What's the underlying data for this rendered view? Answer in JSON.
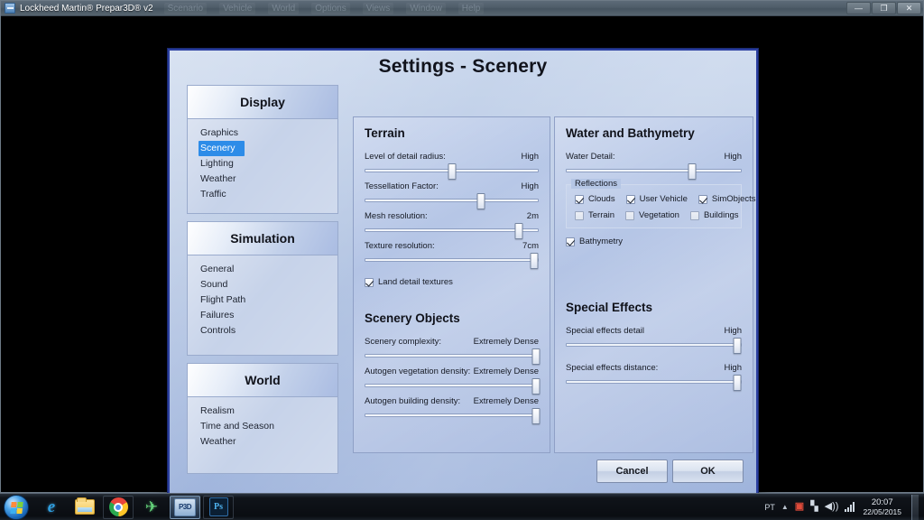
{
  "window": {
    "title": "Lockheed Martin® Prepar3D® v2",
    "icon": "app-icon",
    "menu": [
      "Scenario",
      "Vehicle",
      "World",
      "Options",
      "Views",
      "Window",
      "Help"
    ],
    "controls": {
      "minimize": "—",
      "maximize": "❐",
      "close": "✕"
    }
  },
  "dialog": {
    "title": "Settings - Scenery",
    "buttons": {
      "cancel": "Cancel",
      "ok": "OK"
    }
  },
  "nav": {
    "sections": [
      {
        "header": "Display",
        "items": [
          "Graphics",
          "Scenery",
          "Lighting",
          "Weather",
          "Traffic"
        ],
        "selected": "Scenery"
      },
      {
        "header": "Simulation",
        "items": [
          "General",
          "Sound",
          "Flight Path",
          "Failures",
          "Controls"
        ],
        "selected": ""
      },
      {
        "header": "World",
        "items": [
          "Realism",
          "Time and Season",
          "Weather"
        ],
        "selected": ""
      }
    ]
  },
  "terrain": {
    "title": "Terrain",
    "sliders": [
      {
        "label": "Level of detail radius:",
        "value": "High",
        "percent": 50
      },
      {
        "label": "Tessellation Factor:",
        "value": "High",
        "percent": 67
      },
      {
        "label": "Mesh resolution:",
        "value": "2m",
        "percent": 89
      },
      {
        "label": "Texture resolution:",
        "value": "7cm",
        "percent": 98
      }
    ],
    "land_detail_textures": {
      "label": "Land detail textures",
      "checked": true
    }
  },
  "scenery_objects": {
    "title": "Scenery Objects",
    "sliders": [
      {
        "label": "Scenery complexity:",
        "value": "Extremely Dense",
        "percent": 100
      },
      {
        "label": "Autogen vegetation density:",
        "value": "Extremely Dense",
        "percent": 100
      },
      {
        "label": "Autogen building density:",
        "value": "Extremely Dense",
        "percent": 100
      }
    ]
  },
  "water": {
    "title": "Water and Bathymetry",
    "sliders": [
      {
        "label": "Water Detail:",
        "value": "High",
        "percent": 72
      }
    ],
    "reflections": {
      "legend": "Reflections",
      "row1": [
        {
          "label": "Clouds",
          "checked": true
        },
        {
          "label": "User Vehicle",
          "checked": true
        },
        {
          "label": "SimObjects",
          "checked": true
        }
      ],
      "row2": [
        {
          "label": "Terrain",
          "checked": false
        },
        {
          "label": "Vegetation",
          "checked": false
        },
        {
          "label": "Buildings",
          "checked": false
        }
      ]
    },
    "bathymetry": {
      "label": "Bathymetry",
      "checked": true
    }
  },
  "special_effects": {
    "title": "Special Effects",
    "sliders": [
      {
        "label": "Special effects detail",
        "value": "High",
        "percent": 97
      },
      {
        "label": "Special effects distance:",
        "value": "High",
        "percent": 97
      }
    ]
  },
  "taskbar": {
    "start": "start-orb",
    "tasks": [
      {
        "name": "internet-explorer",
        "glyph": "e"
      },
      {
        "name": "windows-explorer",
        "glyph": ""
      },
      {
        "name": "google-chrome",
        "glyph": ""
      },
      {
        "name": "flight-sim",
        "glyph": "✈"
      },
      {
        "name": "prepar3d",
        "glyph": "P3D"
      },
      {
        "name": "photoshop",
        "glyph": "Ps"
      }
    ],
    "tray": {
      "language": "PT",
      "chevron": "▲",
      "icons": [
        "antivirus-icon",
        "network-icon",
        "volume-icon",
        "signal-icon"
      ],
      "volume_glyph": "🔊",
      "network_glyph": "🖧",
      "time": "20:07",
      "date": "22/05/2015"
    }
  }
}
